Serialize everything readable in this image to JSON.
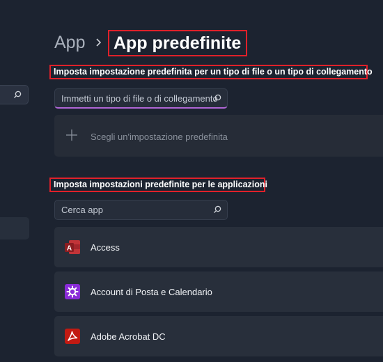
{
  "breadcrumb": {
    "root": "App",
    "separator": "›",
    "current": "App predefinite"
  },
  "filetype_section": {
    "heading": "Imposta impostazione predefinita per un tipo di file o un tipo di collegamento",
    "search_value": "Immetti un tipo di file o di collegamento",
    "choose_default_label": "Scegli un'impostazione predefinita"
  },
  "apps_section": {
    "heading": "Imposta impostazioni predefinite per le applicazioni",
    "search_placeholder": "Cerca app",
    "apps": [
      {
        "name": "Access",
        "icon": "access-icon"
      },
      {
        "name": "Account di Posta e Calendario",
        "icon": "gear-icon"
      },
      {
        "name": "Adobe Acrobat DC",
        "icon": "acrobat-icon"
      }
    ]
  },
  "colors": {
    "background": "#1c2330",
    "highlight_border": "#e0202a",
    "focus_underline": "#b066d6",
    "access_red": "#a4262c",
    "mail_purple": "#8a2bd8",
    "acrobat_red": "#c21a12"
  }
}
